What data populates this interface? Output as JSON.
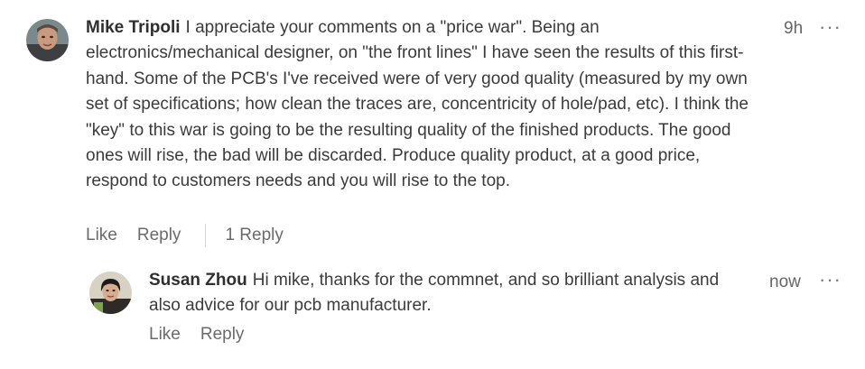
{
  "comments": [
    {
      "author": "Mike Tripoli",
      "text": "I appreciate your comments on a \"price war\". Being an electronics/mechanical designer, on \"the front lines\" I have seen the results of this first-hand. Some of the PCB's I've received were of very good quality (measured by my own set of specifications; how clean the traces are, concentricity of hole/pad, etc). I think the \"key\" to this war is going to be the resulting quality of the finished products. The good ones will rise, the bad will be discarded. Produce quality product, at a good price, respond to customers needs and you will rise to the top.",
      "time": "9h",
      "like_label": "Like",
      "reply_label": "Reply",
      "replies_count_label": "1 Reply",
      "more_icon": "ellipsis-icon"
    },
    {
      "author": "Susan Zhou",
      "text": "Hi mike, thanks for the commnet, and so brilliant analysis and also advice for our pcb manufacturer.",
      "time": "now",
      "like_label": "Like",
      "reply_label": "Reply",
      "more_icon": "ellipsis-icon"
    }
  ],
  "colors": {
    "text": "#3b3b3b",
    "meta": "#666666",
    "divider": "#d6d6d6"
  }
}
